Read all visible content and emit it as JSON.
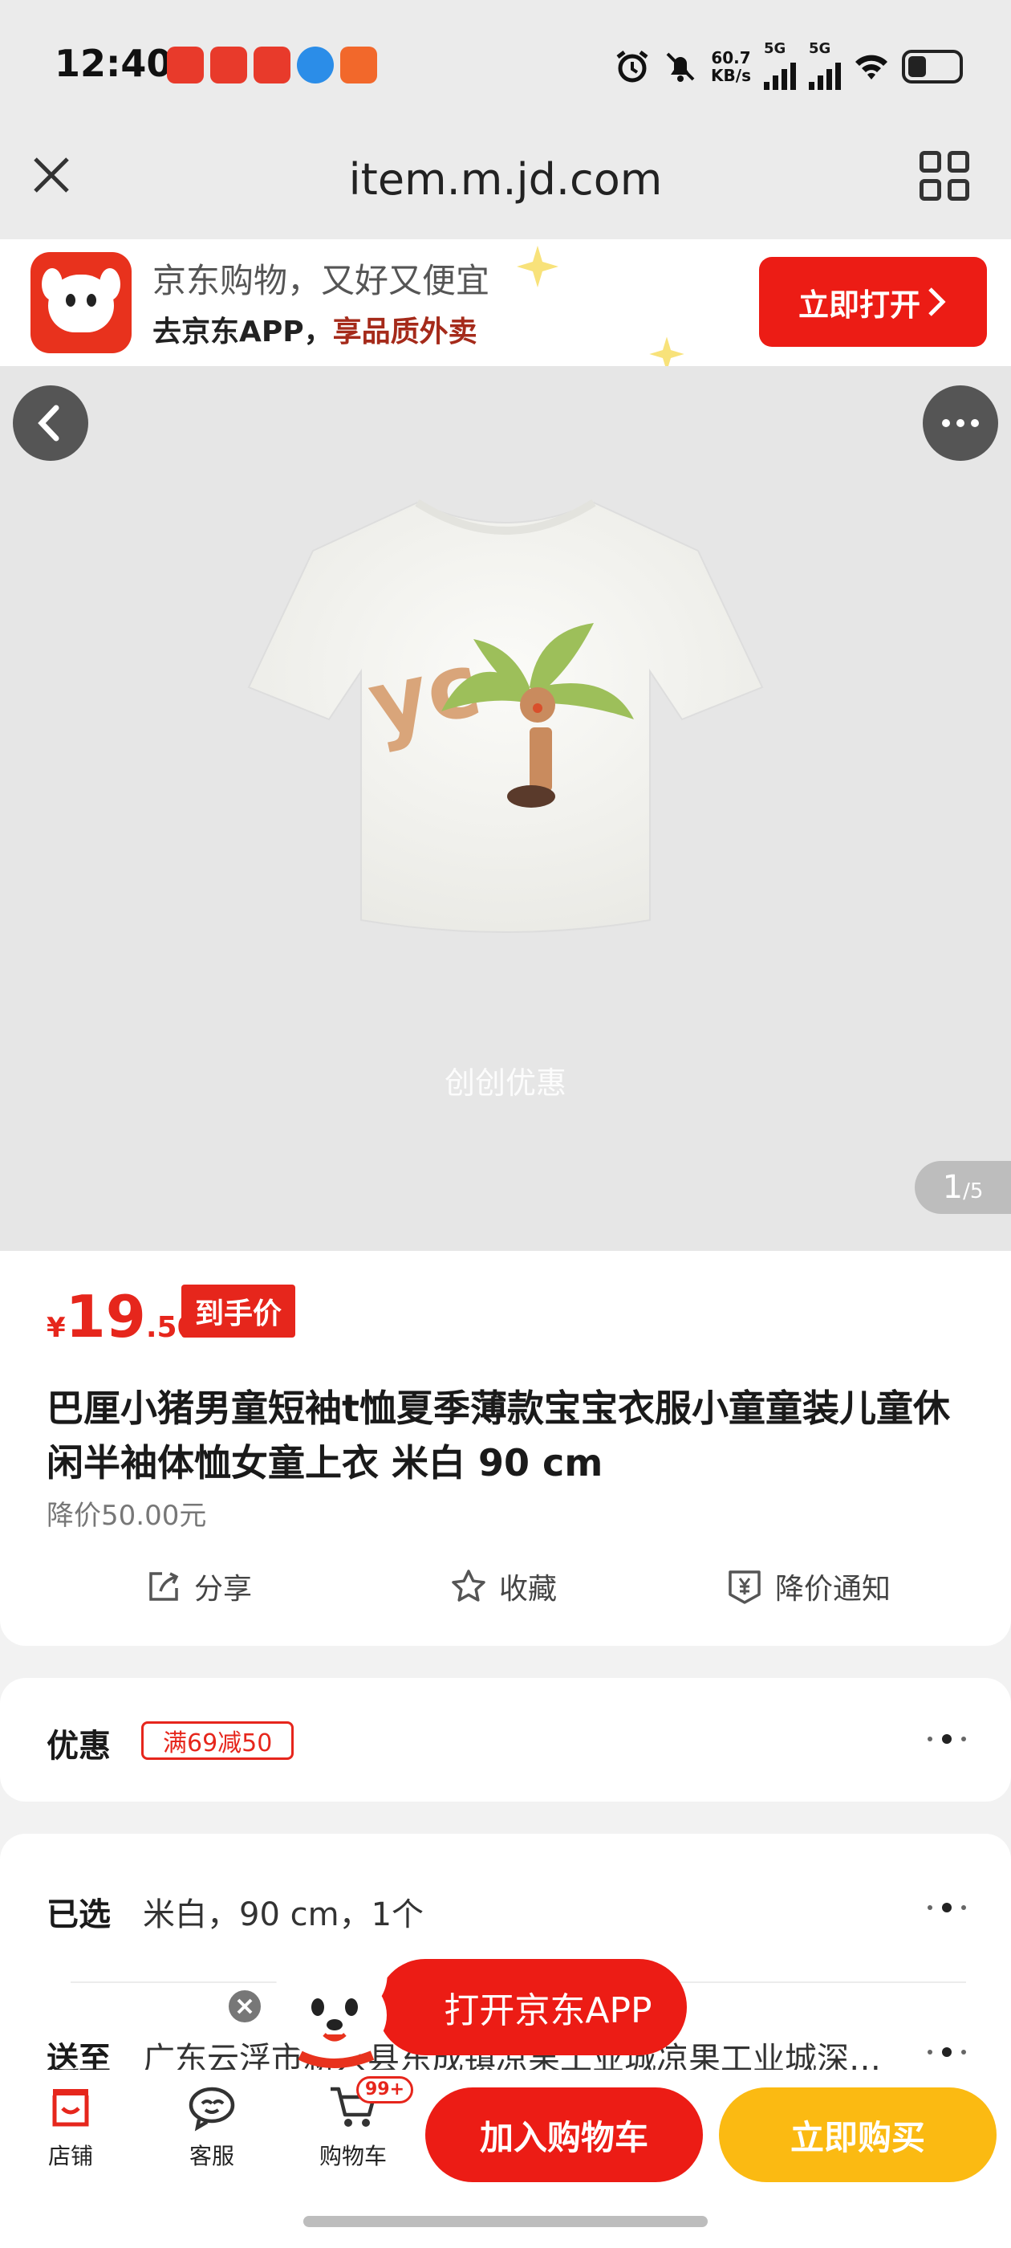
{
  "status_bar": {
    "time": "12:40",
    "net_speed_value": "60.7",
    "net_speed_unit": "KB/s",
    "signal1_label": "5G",
    "signal2_label": "5G"
  },
  "browser": {
    "url": "item.m.jd.com"
  },
  "promo_banner": {
    "line1": "京东购物，又好又便宜",
    "line2_prefix": "去京东APP，",
    "line2_highlight": "享品质外卖",
    "open_button": "立即打开"
  },
  "gallery": {
    "watermark": "创创优惠",
    "current": "1",
    "total": "/5"
  },
  "product": {
    "price_currency": "¥",
    "price_int": "19",
    "price_dec": ".50",
    "price_tag": "到手价",
    "title": "巴厘小猪男童短袖t恤夏季薄款宝宝衣服小童童装儿童休闲半袖体恤女童上衣 米白 90 cm",
    "price_drop": "降价50.00元",
    "actions": {
      "share": "分享",
      "favorite": "收藏",
      "price_alert": "降价通知"
    }
  },
  "discount": {
    "label": "优惠",
    "coupon": "满69减50"
  },
  "selection": {
    "label": "已选",
    "value": "米白，90 cm，1个",
    "ship_label": "送至",
    "ship_value": "广东云浮市新兴县东成镇凉果工业城凉果工业城深…"
  },
  "float_open_app": "打开京东APP",
  "bottom_bar": {
    "store": "店铺",
    "service": "客服",
    "cart": "购物车",
    "cart_badge": "99+",
    "add_to_cart": "加入购物车",
    "buy_now": "立即购买"
  },
  "colors": {
    "brand_red": "#ec1c15",
    "price_red": "#e6261c",
    "buy_yellow": "#fbba12"
  }
}
